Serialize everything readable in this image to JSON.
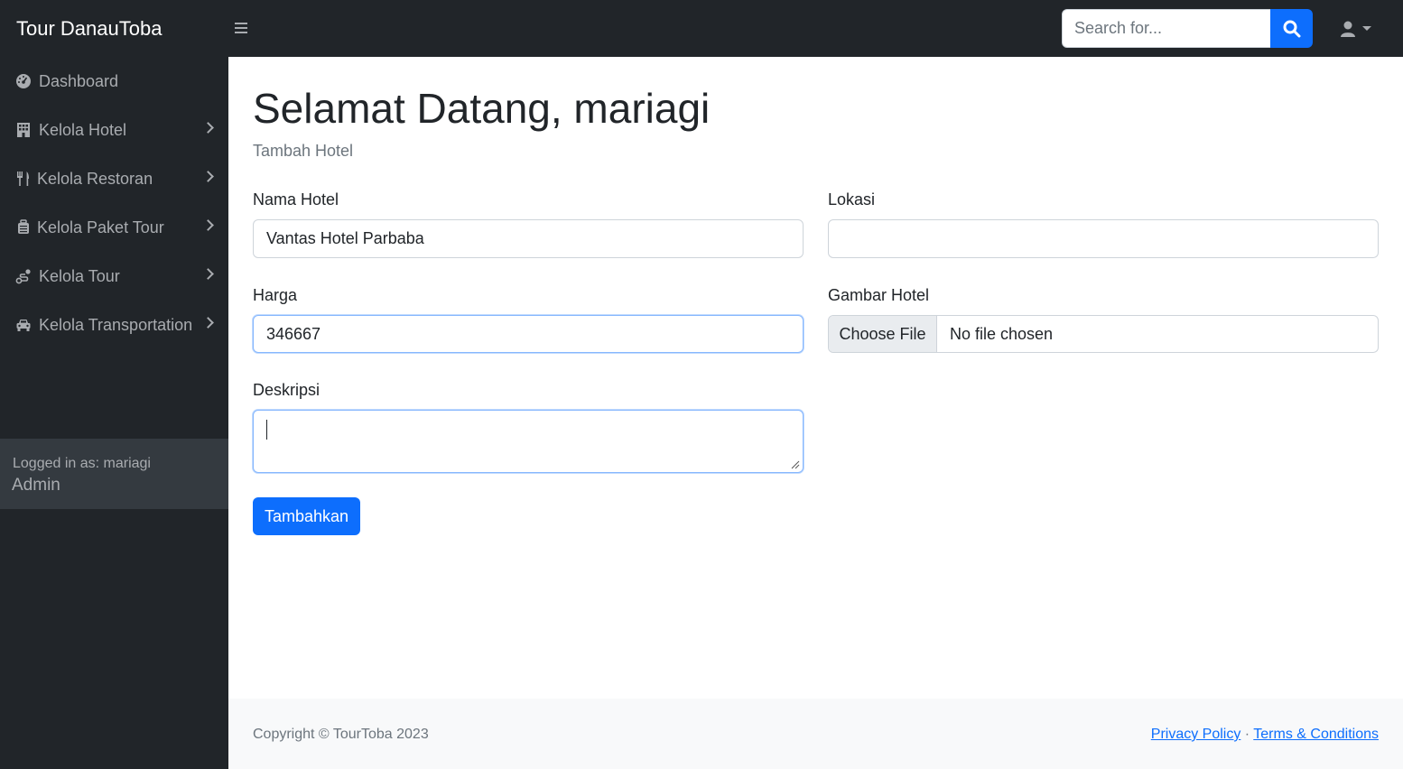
{
  "navbar": {
    "brand": "Tour DanauToba",
    "search_placeholder": "Search for...",
    "toggle_icon": "bars-icon",
    "search_icon": "search-icon",
    "user_icon": "user-icon"
  },
  "sidebar": {
    "items": [
      {
        "label": "Dashboard",
        "icon": "tachometer-icon",
        "has_submenu": false
      },
      {
        "label": "Kelola Hotel",
        "icon": "building-icon",
        "has_submenu": true
      },
      {
        "label": "Kelola Restoran",
        "icon": "utensils-icon",
        "has_submenu": true
      },
      {
        "label": "Kelola Paket Tour",
        "icon": "suitcase-icon",
        "has_submenu": true
      },
      {
        "label": "Kelola Tour",
        "icon": "route-icon",
        "has_submenu": true
      },
      {
        "label": "Kelola Transportation",
        "icon": "car-icon",
        "has_submenu": true
      }
    ],
    "footer": {
      "logged_in_label": "Logged in as: mariagi",
      "role": "Admin"
    }
  },
  "main": {
    "title": "Selamat Datang, mariagi",
    "subtitle": "Tambah Hotel",
    "form": {
      "nama_hotel": {
        "label": "Nama Hotel",
        "value": "Vantas Hotel Parbaba"
      },
      "lokasi": {
        "label": "Lokasi",
        "value": ""
      },
      "harga": {
        "label": "Harga",
        "value": "346667"
      },
      "gambar": {
        "label": "Gambar Hotel",
        "button": "Choose File",
        "status": "No file chosen"
      },
      "deskripsi": {
        "label": "Deskripsi",
        "value": ""
      },
      "submit": "Tambahkan"
    }
  },
  "footer": {
    "copyright": "Copyright © TourToba 2023",
    "privacy": "Privacy Policy",
    "separator": "·",
    "terms": "Terms & Conditions"
  },
  "colors": {
    "dark": "#212529",
    "sidebar_footer": "#343a40",
    "primary": "#0d6efd",
    "muted": "#6c757d"
  }
}
